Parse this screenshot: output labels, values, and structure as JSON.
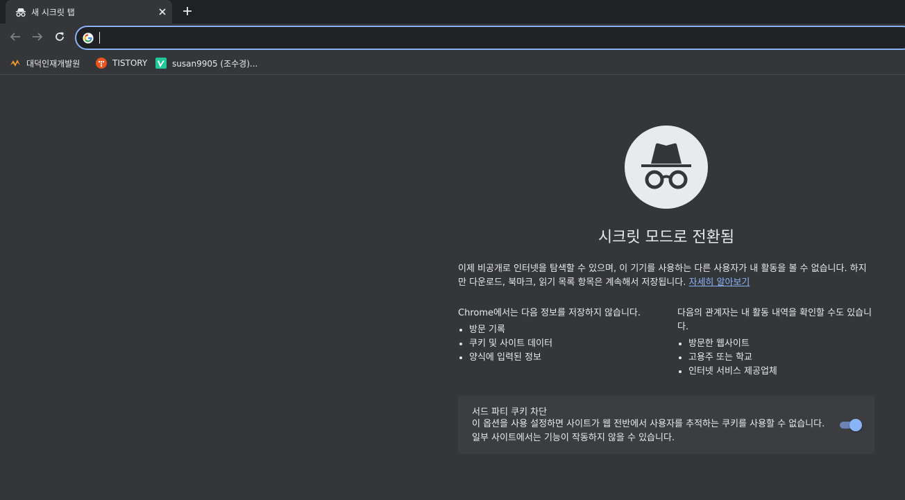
{
  "tab": {
    "title": "새 시크릿 탭",
    "icon": "incognito-icon",
    "close_icon": "close-icon"
  },
  "newtab": {
    "icon": "plus-icon"
  },
  "toolbar": {
    "back_icon": "back-arrow-icon",
    "forward_icon": "forward-arrow-icon",
    "reload_icon": "reload-icon",
    "omnibox": {
      "value": "",
      "search_engine_icon": "google-icon"
    }
  },
  "bookmarks": [
    {
      "label": "대덕인재개발원",
      "icon": "dd-logo-icon"
    },
    {
      "label": "TISTORY",
      "icon": "tistory-icon"
    },
    {
      "label": "susan9905 (조수경)...",
      "icon": "velog-icon"
    }
  ],
  "main": {
    "hero_icon": "incognito-icon",
    "heading": "시크릿 모드로 전환됨",
    "intro_text": "이제 비공개로 인터넷을 탐색할 수 있으며, 이 기기를 사용하는 다른 사용자가 내 활동을 볼 수 없습니다. 하지만 다운로드, 북마크, 읽기 목록 항목은 계속해서 저장됩니다.",
    "learn_more": "자세히 알아보기",
    "left_column": {
      "title": "Chrome에서는 다음 정보를 저장하지 않습니다.",
      "items": [
        "방문 기록",
        "쿠키 및 사이트 데이터",
        "양식에 입력된 정보"
      ]
    },
    "right_column": {
      "title": "다음의 관계자는 내 활동 내역을 확인할 수도 있습니다.",
      "items": [
        "방문한 웹사이트",
        "고용주 또는 학교",
        "인터넷 서비스 제공업체"
      ]
    },
    "cookie_card": {
      "title": "서드 파티 쿠키 차단",
      "description": "이 옵션을 사용 설정하면 사이트가 웹 전반에서 사용자를 추적하는 쿠키를 사용할 수 없습니다. 일부 사이트에서는 기능이 작동하지 않을 수 있습니다.",
      "toggle_on": true
    }
  },
  "colors": {
    "tabstrip_bg": "#202124",
    "surface": "#35363a",
    "card_bg": "#3c3d41",
    "accent": "#8ab4f8",
    "text": "#e8eaed"
  }
}
